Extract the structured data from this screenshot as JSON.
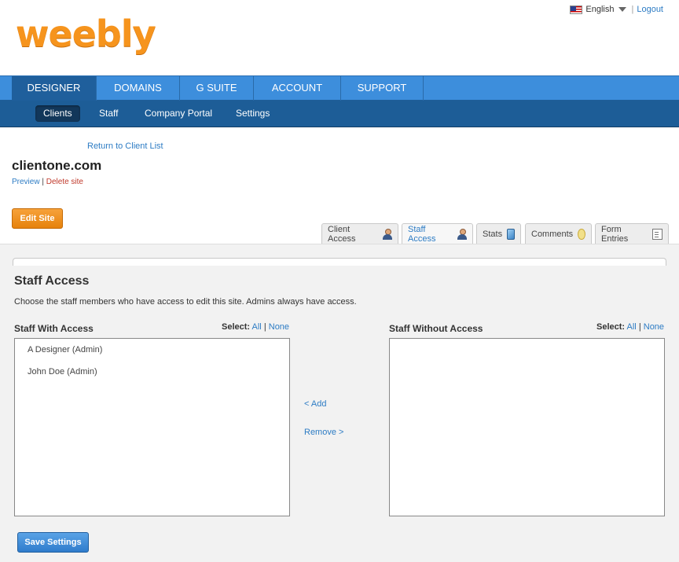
{
  "header": {
    "logo_text": "weebly",
    "language": "English",
    "separator": "|",
    "logout": "Logout"
  },
  "main_nav": {
    "items": [
      {
        "label": "DESIGNER",
        "active": true
      },
      {
        "label": "DOMAINS",
        "active": false
      },
      {
        "label": "G SUITE",
        "active": false
      },
      {
        "label": "ACCOUNT",
        "active": false
      },
      {
        "label": "SUPPORT",
        "active": false
      }
    ]
  },
  "sub_nav": {
    "items": [
      {
        "label": "Clients",
        "active": true
      },
      {
        "label": "Staff",
        "active": false
      },
      {
        "label": "Company Portal",
        "active": false
      },
      {
        "label": "Settings",
        "active": false
      }
    ]
  },
  "site": {
    "return_link": "Return to Client List",
    "name": "clientone.com",
    "preview": "Preview",
    "separator": "|",
    "delete": "Delete site",
    "edit_button": "Edit Site"
  },
  "tabs": [
    {
      "label": "Client Access",
      "icon": "person-icon",
      "active": false
    },
    {
      "label": "Staff Access",
      "icon": "person-icon",
      "active": true
    },
    {
      "label": "Stats",
      "icon": "stats-icon",
      "active": false
    },
    {
      "label": "Comments",
      "icon": "comment-icon",
      "active": false
    },
    {
      "label": "Form Entries",
      "icon": "form-icon",
      "active": false
    }
  ],
  "panel": {
    "title": "Staff Access",
    "description": "Choose the staff members who have access to edit this site. Admins always have access.",
    "with_access": {
      "heading": "Staff With Access",
      "members": [
        "A Designer (Admin)",
        "John Doe (Admin)"
      ]
    },
    "without_access": {
      "heading": "Staff Without Access",
      "members": []
    },
    "select_label": "Select:",
    "select_all": "All",
    "select_sep": "|",
    "select_none": "None",
    "add_link": "< Add",
    "remove_link": "Remove >",
    "save_button": "Save Settings"
  },
  "colors": {
    "brand_orange": "#f6941d",
    "nav_blue": "#3d8edc",
    "subnav_blue": "#1d5d97",
    "link_blue": "#2d7cc4",
    "delete_red": "#c0392b"
  }
}
